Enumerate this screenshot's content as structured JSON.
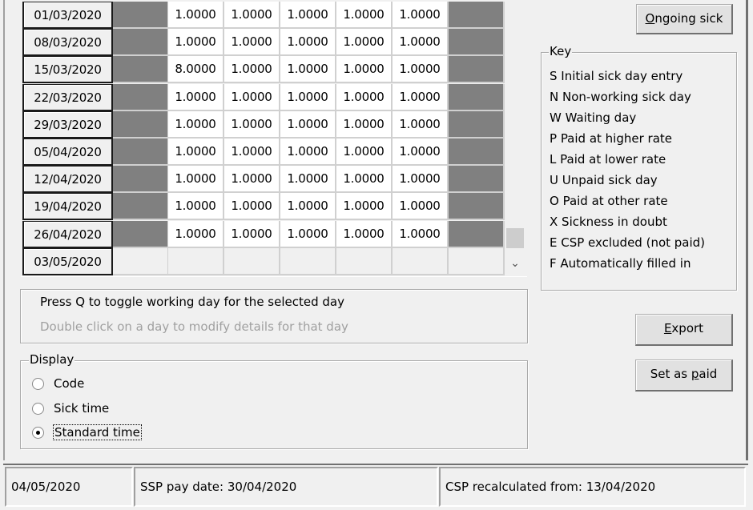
{
  "grid": {
    "rows": [
      {
        "date": "01/03/2020",
        "values": [
          "1.0000",
          "1.0000",
          "1.0000",
          "1.0000",
          "1.0000"
        ],
        "filled": true
      },
      {
        "date": "08/03/2020",
        "values": [
          "1.0000",
          "1.0000",
          "1.0000",
          "1.0000",
          "1.0000"
        ],
        "filled": true
      },
      {
        "date": "15/03/2020",
        "values": [
          "8.0000",
          "1.0000",
          "1.0000",
          "1.0000",
          "1.0000"
        ],
        "filled": true
      },
      {
        "date": "22/03/2020",
        "values": [
          "1.0000",
          "1.0000",
          "1.0000",
          "1.0000",
          "1.0000"
        ],
        "filled": true
      },
      {
        "date": "29/03/2020",
        "values": [
          "1.0000",
          "1.0000",
          "1.0000",
          "1.0000",
          "1.0000"
        ],
        "filled": true
      },
      {
        "date": "05/04/2020",
        "values": [
          "1.0000",
          "1.0000",
          "1.0000",
          "1.0000",
          "1.0000"
        ],
        "filled": true
      },
      {
        "date": "12/04/2020",
        "values": [
          "1.0000",
          "1.0000",
          "1.0000",
          "1.0000",
          "1.0000"
        ],
        "filled": true
      },
      {
        "date": "19/04/2020",
        "values": [
          "1.0000",
          "1.0000",
          "1.0000",
          "1.0000",
          "1.0000"
        ],
        "filled": true
      },
      {
        "date": "26/04/2020",
        "values": [
          "1.0000",
          "1.0000",
          "1.0000",
          "1.0000",
          "1.0000"
        ],
        "filled": true
      },
      {
        "date": "03/05/2020",
        "values": [
          "",
          "",
          "",
          "",
          ""
        ],
        "filled": false
      }
    ],
    "scroll_down_icon": "⌄"
  },
  "hints": {
    "line1": "Press Q to toggle working day for the selected day",
    "line2": "Double click on a day to modify details for that day"
  },
  "display": {
    "legend": "Display",
    "options": [
      {
        "label": "Code",
        "selected": false
      },
      {
        "label": "Sick time",
        "selected": false
      },
      {
        "label": "Standard time",
        "selected": true
      }
    ]
  },
  "buttons": {
    "ongoing_sick": {
      "mnemonic": "O",
      "rest": "ngoing sick"
    },
    "export": {
      "mnemonic": "E",
      "rest": "xport"
    },
    "set_as_paid": {
      "pre": "Set as ",
      "mnemonic": "p",
      "rest": "aid"
    }
  },
  "key": {
    "legend": "Key",
    "items": [
      "S Initial sick day entry",
      "N Non-working sick day",
      "W Waiting day",
      "P Paid at higher rate",
      "L Paid at lower rate",
      "U Unpaid sick day",
      "O Paid at other rate",
      "X Sickness in doubt",
      "E CSP excluded (not paid)",
      "F Automatically filled in"
    ]
  },
  "statusbar": {
    "date": "04/05/2020",
    "ssp_pay_date": "SSP pay date: 30/04/2020",
    "csp_recalculated": "CSP recalculated from: 13/04/2020"
  }
}
